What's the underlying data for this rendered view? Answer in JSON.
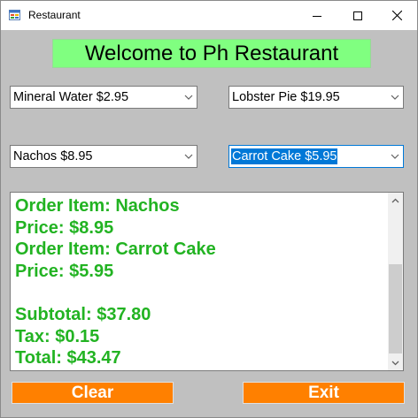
{
  "window": {
    "title": "Restaurant",
    "icon": "form-icon",
    "controls": {
      "minimize_icon": "minimize-icon",
      "maximize_icon": "maximize-icon",
      "close_icon": "close-icon"
    }
  },
  "header": {
    "welcome": "Welcome to Ph Restaurant",
    "background_color": "#80ff80"
  },
  "menus": {
    "drink": {
      "selected": "Mineral Water $2.95"
    },
    "main_course": {
      "selected": "Lobster Pie $19.95"
    },
    "appetizer": {
      "selected": "Nachos $8.95"
    },
    "dessert": {
      "selected": "Carrot Cake $5.95"
    }
  },
  "receipt": {
    "text_color": "#22b322",
    "lines": [
      "Order Item: Nachos",
      "Price: $8.95",
      "Order Item: Carrot Cake",
      "Price: $5.95",
      "",
      "Subtotal: $37.80",
      "Tax: $0.15",
      "Total: $43.47"
    ]
  },
  "buttons": {
    "clear": "Clear",
    "exit": "Exit",
    "color": "#ff8000"
  }
}
